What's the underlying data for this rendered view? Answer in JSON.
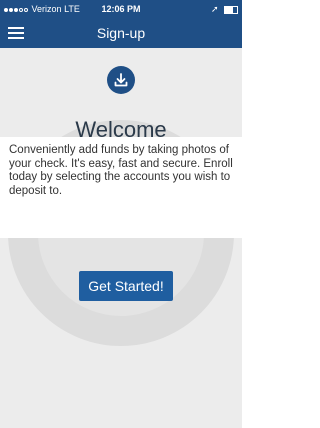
{
  "status_bar": {
    "carrier": "Verizon",
    "network": "LTE",
    "time": "12:06 PM"
  },
  "header": {
    "title": "Sign-up"
  },
  "content": {
    "welcome_title": "Welcome",
    "message": "Conveniently add funds by taking photos of your check. It's easy, fast and secure. Enroll today by selecting the accounts you wish to deposit to.",
    "cta_label": "Get Started!"
  },
  "icons": {
    "menu": "hamburger-menu-icon",
    "welcome": "download-icon",
    "location": "location-arrow-icon",
    "battery": "battery-icon"
  },
  "colors": {
    "primary": "#1f4f86",
    "button": "#1f5ea0",
    "background": "#ececec"
  }
}
